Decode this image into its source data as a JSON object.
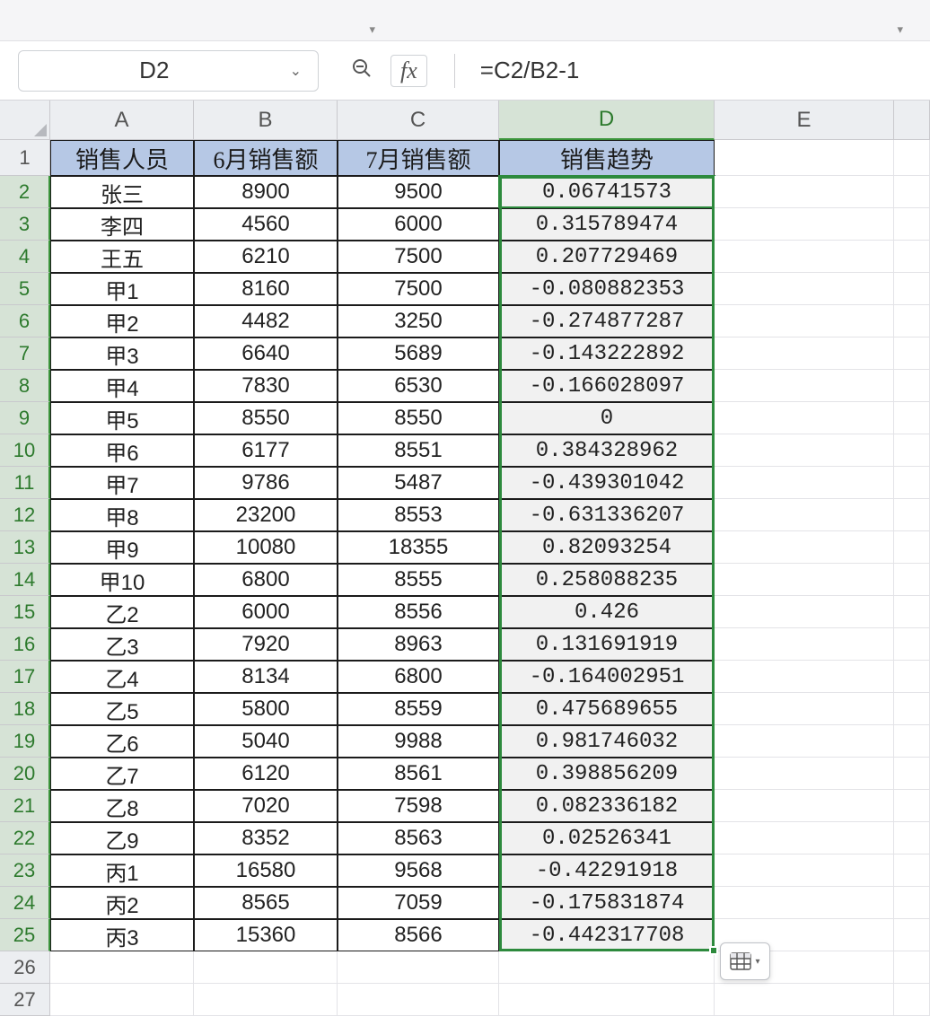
{
  "namebox": {
    "cell_ref": "D2"
  },
  "formula_bar": {
    "formula": "=C2/B2-1",
    "fx_label": "fx"
  },
  "columns": [
    "A",
    "B",
    "C",
    "D",
    "E"
  ],
  "selected_column": "D",
  "selected_rows_start": 2,
  "selected_rows_end": 25,
  "header_row": {
    "A": "销售人员",
    "B": "6月销售额",
    "C": "7月销售额",
    "D": "销售趋势"
  },
  "data_rows": [
    {
      "r": 2,
      "A": "张三",
      "B": "8900",
      "C": "9500",
      "D": "0.06741573"
    },
    {
      "r": 3,
      "A": "李四",
      "B": "4560",
      "C": "6000",
      "D": "0.315789474"
    },
    {
      "r": 4,
      "A": "王五",
      "B": "6210",
      "C": "7500",
      "D": "0.207729469"
    },
    {
      "r": 5,
      "A": "甲1",
      "B": "8160",
      "C": "7500",
      "D": "-0.080882353"
    },
    {
      "r": 6,
      "A": "甲2",
      "B": "4482",
      "C": "3250",
      "D": "-0.274877287"
    },
    {
      "r": 7,
      "A": "甲3",
      "B": "6640",
      "C": "5689",
      "D": "-0.143222892"
    },
    {
      "r": 8,
      "A": "甲4",
      "B": "7830",
      "C": "6530",
      "D": "-0.166028097"
    },
    {
      "r": 9,
      "A": "甲5",
      "B": "8550",
      "C": "8550",
      "D": "0"
    },
    {
      "r": 10,
      "A": "甲6",
      "B": "6177",
      "C": "8551",
      "D": "0.384328962"
    },
    {
      "r": 11,
      "A": "甲7",
      "B": "9786",
      "C": "5487",
      "D": "-0.439301042"
    },
    {
      "r": 12,
      "A": "甲8",
      "B": "23200",
      "C": "8553",
      "D": "-0.631336207"
    },
    {
      "r": 13,
      "A": "甲9",
      "B": "10080",
      "C": "18355",
      "D": "0.82093254"
    },
    {
      "r": 14,
      "A": "甲10",
      "B": "6800",
      "C": "8555",
      "D": "0.258088235"
    },
    {
      "r": 15,
      "A": "乙2",
      "B": "6000",
      "C": "8556",
      "D": "0.426"
    },
    {
      "r": 16,
      "A": "乙3",
      "B": "7920",
      "C": "8963",
      "D": "0.131691919"
    },
    {
      "r": 17,
      "A": "乙4",
      "B": "8134",
      "C": "6800",
      "D": "-0.164002951"
    },
    {
      "r": 18,
      "A": "乙5",
      "B": "5800",
      "C": "8559",
      "D": "0.475689655"
    },
    {
      "r": 19,
      "A": "乙6",
      "B": "5040",
      "C": "9988",
      "D": "0.981746032"
    },
    {
      "r": 20,
      "A": "乙7",
      "B": "6120",
      "C": "8561",
      "D": "0.398856209"
    },
    {
      "r": 21,
      "A": "乙8",
      "B": "7020",
      "C": "7598",
      "D": "0.082336182"
    },
    {
      "r": 22,
      "A": "乙9",
      "B": "8352",
      "C": "8563",
      "D": "0.02526341"
    },
    {
      "r": 23,
      "A": "丙1",
      "B": "16580",
      "C": "9568",
      "D": "-0.42291918"
    },
    {
      "r": 24,
      "A": "丙2",
      "B": "8565",
      "C": "7059",
      "D": "-0.175831874"
    },
    {
      "r": 25,
      "A": "丙3",
      "B": "15360",
      "C": "8566",
      "D": "-0.442317708"
    }
  ],
  "empty_rows": [
    26,
    27
  ],
  "icons": {
    "chevron_down": "chevron-down-icon",
    "zoom": "zoom-out-icon",
    "select_all": "select-all-triangle-icon",
    "autofill": "autofill-options-icon"
  }
}
